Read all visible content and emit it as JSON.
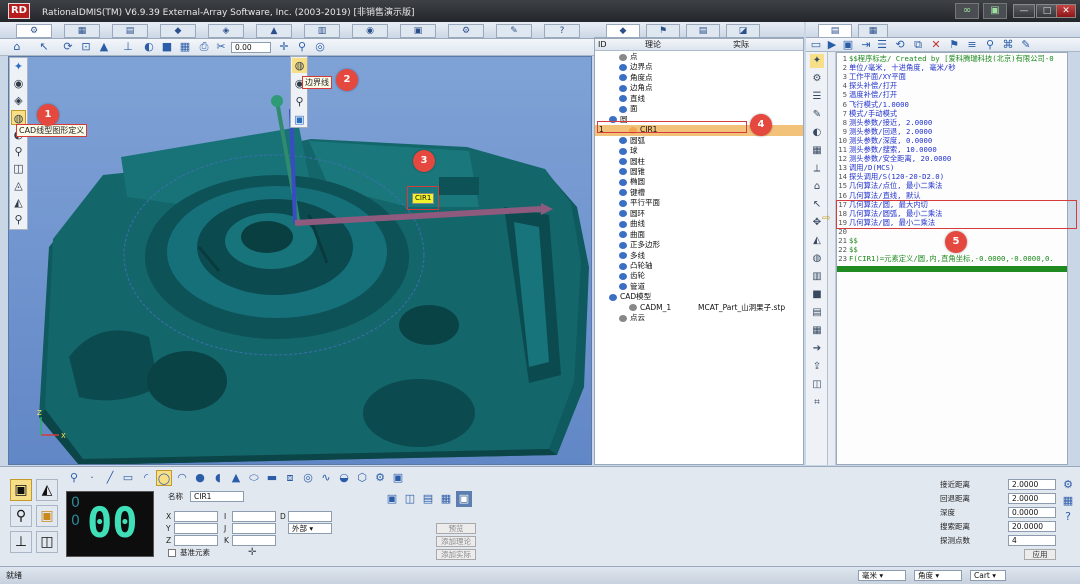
{
  "window": {
    "title": "RationalDMIS(TM) V6.9.39    External-Array Software, Inc. (2003-2019) [非销售演示版]",
    "app_icon": "RD"
  },
  "viewport": {
    "axis_labels": {
      "x": "X",
      "z": "Z"
    },
    "label_cir1": "CIR1"
  },
  "toolbar": {
    "zoom_value": "0.00"
  },
  "tooltips": {
    "cad_def": "CAD线型图形定义",
    "boundary": "边界线"
  },
  "markers": [
    "1",
    "2",
    "3",
    "4",
    "5"
  ],
  "tree": {
    "headers": {
      "id": "ID",
      "nominal": "理论",
      "actual": "实际"
    },
    "items": [
      {
        "label": "点",
        "indent": 1,
        "color": "#888888"
      },
      {
        "label": "边界点",
        "indent": 1,
        "color": "#3b6fc4"
      },
      {
        "label": "角度点",
        "indent": 1,
        "color": "#3b6fc4"
      },
      {
        "label": "边角点",
        "indent": 1,
        "color": "#3b6fc4"
      },
      {
        "label": "直线",
        "indent": 1,
        "color": "#3b6fc4"
      },
      {
        "label": "面",
        "indent": 1,
        "color": "#3b6fc4"
      },
      {
        "label": "圆",
        "indent": 0,
        "color": "#3b6fc4"
      },
      {
        "label": "CIR1",
        "indent": 2,
        "color": "#f2a64f",
        "id": "1"
      },
      {
        "label": "圆弧",
        "indent": 1,
        "color": "#3b6fc4"
      },
      {
        "label": "球",
        "indent": 1,
        "color": "#3b6fc4"
      },
      {
        "label": "圆柱",
        "indent": 1,
        "color": "#3b6fc4"
      },
      {
        "label": "圆锥",
        "indent": 1,
        "color": "#3b6fc4"
      },
      {
        "label": "椭圆",
        "indent": 1,
        "color": "#3b6fc4"
      },
      {
        "label": "键槽",
        "indent": 1,
        "color": "#3b6fc4"
      },
      {
        "label": "平行平面",
        "indent": 1,
        "color": "#3b6fc4"
      },
      {
        "label": "圆环",
        "indent": 1,
        "color": "#3b6fc4"
      },
      {
        "label": "曲线",
        "indent": 1,
        "color": "#3b6fc4"
      },
      {
        "label": "曲面",
        "indent": 1,
        "color": "#3b6fc4"
      },
      {
        "label": "正多边形",
        "indent": 1,
        "color": "#3b6fc4"
      },
      {
        "label": "多线",
        "indent": 1,
        "color": "#3b6fc4"
      },
      {
        "label": "凸轮轴",
        "indent": 1,
        "color": "#3b6fc4"
      },
      {
        "label": "齿轮",
        "indent": 1,
        "color": "#3b6fc4"
      },
      {
        "label": "管道",
        "indent": 1,
        "color": "#3b6fc4"
      },
      {
        "label": "CAD模型",
        "indent": 0,
        "color": "#3b6fc4"
      },
      {
        "label": "CADM_1",
        "indent": 2,
        "color": "#888888",
        "actual": "MCAT_Part_山洞果子.stp"
      },
      {
        "label": "点云",
        "indent": 1,
        "color": "#888888"
      }
    ]
  },
  "code": {
    "lines": [
      {
        "n": "1",
        "t": "$$程序标志/ Created by [爱科腾瑞科技(北京)有限公司-0",
        "c": "#1d8a1d"
      },
      {
        "n": "2",
        "t": "单位/毫米, 十进角度, 毫米/秒",
        "c": "#2233cc"
      },
      {
        "n": "3",
        "t": "工作平面/XY平面",
        "c": "#2233cc"
      },
      {
        "n": "4",
        "t": "探头补偿/打开",
        "c": "#2233cc"
      },
      {
        "n": "5",
        "t": "温度补偿/打开",
        "c": "#2233cc"
      },
      {
        "n": "6",
        "t": "飞行模式/1.0000",
        "c": "#2233cc"
      },
      {
        "n": "7",
        "t": "模式/手动模式",
        "c": "#2233cc"
      },
      {
        "n": "8",
        "t": "测头参数/接近, 2.0000",
        "c": "#2233cc"
      },
      {
        "n": "9",
        "t": "测头参数/回退, 2.0000",
        "c": "#2233cc"
      },
      {
        "n": "10",
        "t": "测头参数/深度, 0.0000",
        "c": "#2233cc"
      },
      {
        "n": "11",
        "t": "测头参数/搜索, 10.0000",
        "c": "#2233cc"
      },
      {
        "n": "12",
        "t": "测头参数/安全距离, 20.0000",
        "c": "#2233cc"
      },
      {
        "n": "13",
        "t": "调用/D(MCS)",
        "c": "#2233cc"
      },
      {
        "n": "14",
        "t": "探头调用/S(120-20-D2.0)",
        "c": "#2233cc"
      },
      {
        "n": "15",
        "t": "几何算法/点位, 最小二乘法",
        "c": "#2233cc"
      },
      {
        "n": "16",
        "t": "几何算法/直线, 默认",
        "c": "#2233cc"
      },
      {
        "n": "17",
        "t": "几何算法/圆, 最大内切",
        "c": "#2233cc"
      },
      {
        "n": "18",
        "t": "几何算法/圆弧, 最小二乘法",
        "c": "#2233cc"
      },
      {
        "n": "19",
        "t": "几何算法/圆, 最小二乘法",
        "c": "#2233cc"
      },
      {
        "n": "20",
        "t": "",
        "c": "#2233cc"
      },
      {
        "n": "21",
        "t": "$$",
        "c": "#1d8a1d"
      },
      {
        "n": "22",
        "t": "$$",
        "c": "#1d8a1d"
      },
      {
        "n": "23",
        "t": "F(CIR1)=元素定义/圆,内,直角坐标,-0.0000,-0.0000,0.",
        "c": "#1d8a1d"
      }
    ]
  },
  "bottom": {
    "name_label": "名称",
    "name_value": "CIR1",
    "counter": "00",
    "counter_small": [
      "0",
      "0"
    ],
    "xyz_labels": [
      "X",
      "Y",
      "Z"
    ],
    "ijk_labels": [
      "I",
      "J",
      "K"
    ],
    "d_label": "D",
    "side_select": "外部",
    "ref_checkbox": "基准元素",
    "buttons": [
      "预览",
      "添加理论",
      "添加实际"
    ],
    "params": [
      {
        "label": "接近距离",
        "value": "2.0000"
      },
      {
        "label": "回退距离",
        "value": "2.0000"
      },
      {
        "label": "深度",
        "value": "0.0000"
      },
      {
        "label": "搜索距离",
        "value": "20.0000"
      },
      {
        "label": "探测点数",
        "value": "4"
      }
    ],
    "apply": "应用"
  },
  "status": {
    "ready": "就绪",
    "unit": "毫米",
    "angle": "角度",
    "coord": "Cart"
  },
  "colors": {
    "part": "#13666a",
    "part_dark": "#0b4548",
    "viewport_top": "#7fa2d6",
    "highlight_row": "#f2c27a",
    "code_highlight": "#1f8a1f",
    "marker": "#e5483e"
  }
}
